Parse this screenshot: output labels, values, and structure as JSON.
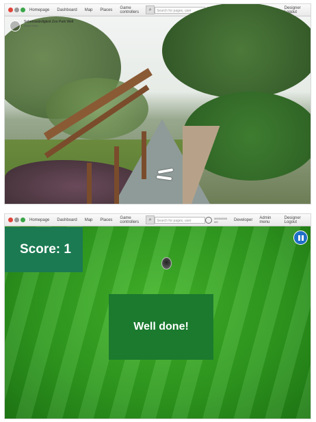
{
  "browser": {
    "nav": [
      "Homepage",
      "Dashboard",
      "Map",
      "Places",
      "Game controllers"
    ],
    "search_placeholder": "Search for pages, user",
    "right": {
      "user_line1": "0000/0000",
      "user_line2": "0/0",
      "menu1": "Developer",
      "menu2": "Admin menu",
      "logout": "Designer Logout"
    }
  },
  "streetview": {
    "title": "Sehenswürdigkeit Zoo Park Welt",
    "subtitle": "Street View"
  },
  "game": {
    "score_label": "Score: 1",
    "message": "Well done!"
  },
  "colors": {
    "score_panel": "#1b7a52",
    "message_panel": "#1b7a2e",
    "pause_button": "#1f6fc6",
    "grass": "#2e9a1e"
  },
  "icons": {
    "search": "magnifier-icon",
    "pause": "pause-icon",
    "compass": "compass-icon",
    "user": "user-icon"
  }
}
